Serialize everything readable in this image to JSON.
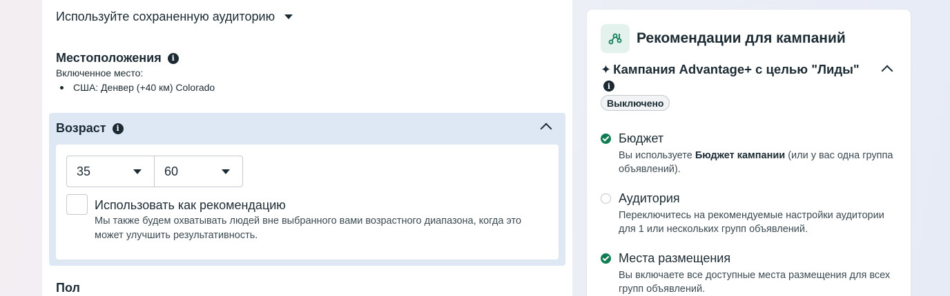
{
  "targeting": {
    "saved_audience_label": "Используйте сохраненную аудиторию",
    "locations": {
      "title": "Местоположения",
      "included_label": "Включенное место:",
      "items": [
        "США: Денвер (+40 км) Colorado"
      ]
    },
    "age": {
      "title": "Возраст",
      "min": "35",
      "max": "60",
      "recommendation_label": "Использовать как рекомендацию",
      "recommendation_desc": "Мы также будем охватывать людей вне выбранного вами возрастного диапазона, когда это может улучшить результативность."
    },
    "gender": {
      "title": "Пол"
    }
  },
  "recommendations": {
    "title": "Рекомендации для кампаний",
    "campaign_title": "Кампания Advantage+ с целью \"Лиды\"",
    "status_badge": "Выключено",
    "items": [
      {
        "title": "Бюджет",
        "desc_prefix": "Вы используете ",
        "desc_bold": "Бюджет кампании",
        "desc_suffix": " (или у вас одна группа объявлений).",
        "done": true
      },
      {
        "title": "Аудитория",
        "desc": "Переключитесь на рекомендуемые настройки аудитории для 1 или нескольких групп объявлений.",
        "done": false
      },
      {
        "title": "Места размещения",
        "desc": "Вы включаете все доступные места размещения для всех групп объявлений.",
        "done": true
      }
    ]
  },
  "icons": {
    "info": "info-icon",
    "dropdown": "caret-down-icon",
    "collapse": "chevron-up-icon",
    "recommendations": "branch-nodes-icon",
    "advantage": "sparkle-icon",
    "done": "check-circle-icon",
    "todo": "empty-circle-icon"
  },
  "colors": {
    "accent_green": "#0f7d54",
    "section_bg": "#dde8f4",
    "icon_bg": "#e4f2ee"
  }
}
